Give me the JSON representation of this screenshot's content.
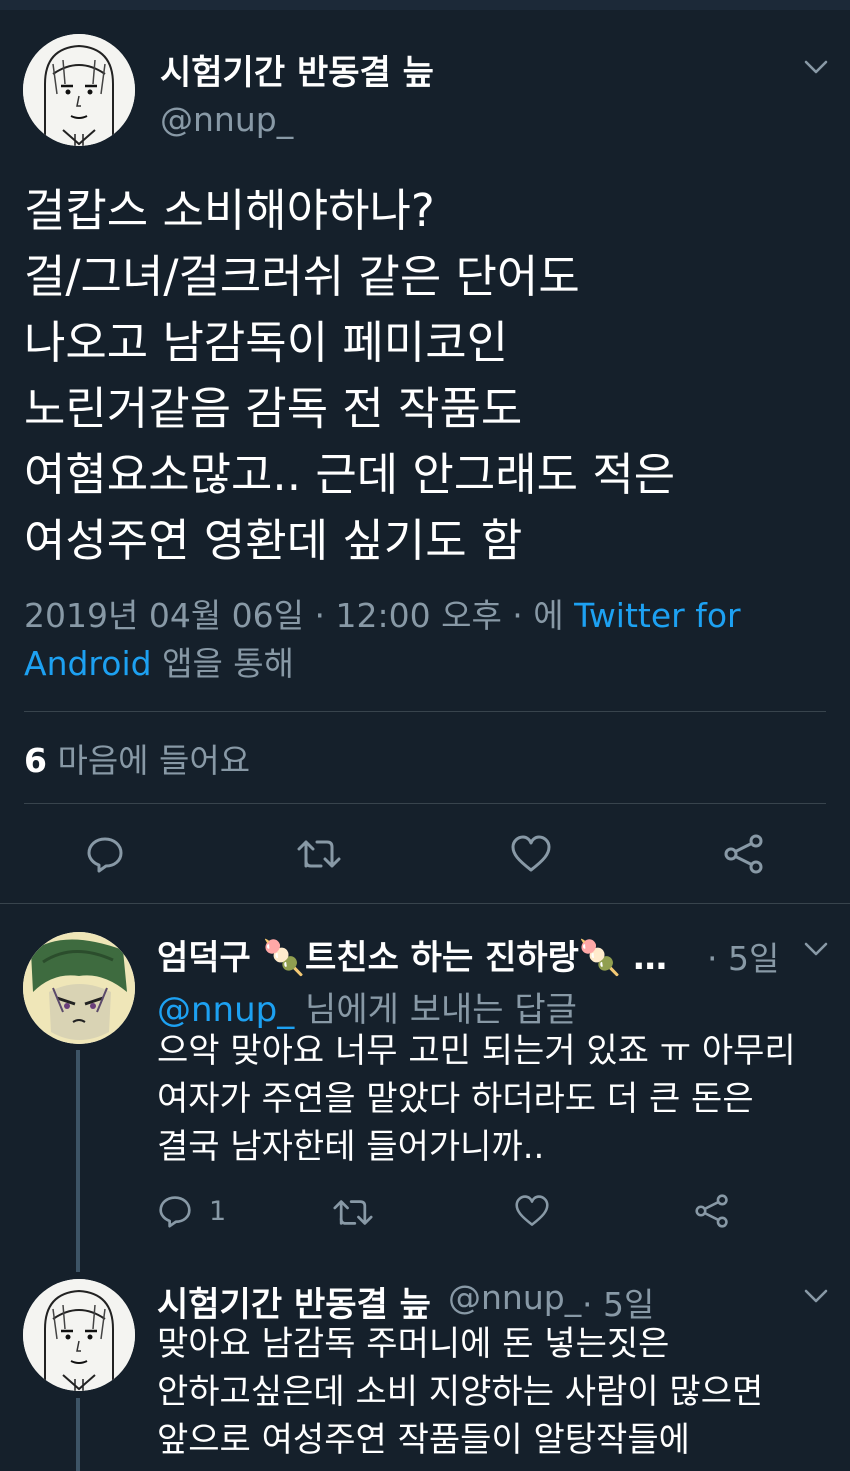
{
  "main_tweet": {
    "display_name": "시험기간 반동결 늪",
    "handle": "@nnup_",
    "text_lines": [
      "걸캅스 소비해야하나?",
      "걸/그녀/걸크러쉬 같은 단어도",
      "나오고 남감독이 페미코인",
      "노린거같음 감독 전 작품도",
      "여혐요소많고.. 근데 안그래도 적은",
      "여성주연 영환데 싶기도 함"
    ],
    "meta_prefix": "2019년 04월 06일 · 12:00 오후 · 에 ",
    "source_app": "Twitter for Android",
    "meta_suffix": " 앱을 통해",
    "like_count": "6",
    "like_label": " 마음에 들어요"
  },
  "replies": [
    {
      "display_name": "엄덕구 🍡트친소 하는 진하랑🍡 …",
      "age": "· 5일",
      "replying_to_handle": "@nnup_",
      "replying_to_suffix": " 님에게 보내는 답글",
      "text_lines": [
        "으악 맞아요 너무 고민 되는거 있죠 ㅠ 아무리",
        "여자가 주연을 맡았다 하더라도 더 큰 돈은",
        "결국 남자한테 들어가니까.."
      ],
      "reply_count": "1"
    },
    {
      "display_name": "시험기간 반동결 늪",
      "handle": "@nnup_",
      "age": "· 5일",
      "text_lines": [
        "맞아요 남감독 주머니에 돈 넣는짓은",
        "안하고싶은데 소비 지양하는 사람이 많으면",
        "앞으로 여성주연 작품들이 알탕작들에"
      ]
    }
  ],
  "icons": [
    "chevron-down-icon",
    "reply-icon",
    "retweet-icon",
    "like-icon",
    "share-icon"
  ],
  "colors": {
    "background": "#15202b",
    "text_primary": "#ffffff",
    "text_secondary": "#8899a6",
    "accent": "#1da1f2",
    "divider": "#38444d"
  }
}
